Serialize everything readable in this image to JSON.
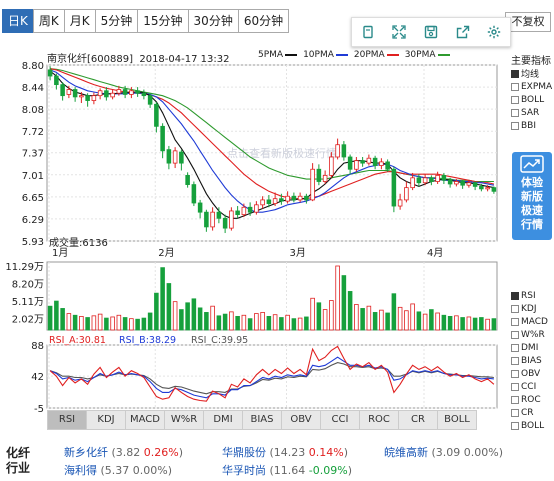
{
  "tabs": [
    "日K",
    "周K",
    "月K",
    "5分钟",
    "15分钟",
    "30分钟",
    "60分钟"
  ],
  "active_tab": 0,
  "fuquan_label": "不复权",
  "toolbar_icons": [
    "copy-icon",
    "fullscreen-icon",
    "save-icon",
    "share-icon",
    "settings-icon"
  ],
  "header": {
    "stock": "南京化纤[600889]",
    "datetime": "2018-04-17 13:32"
  },
  "ma_legend": [
    {
      "label": "5PMA",
      "color": "#111111"
    },
    {
      "label": "10PMA",
      "color": "#1f3bd6"
    },
    {
      "label": "20PMA",
      "color": "#e02020"
    },
    {
      "label": "30PMA",
      "color": "#2e9a2e"
    }
  ],
  "watermark": "点击查看新版极速行情",
  "side_title": "主要指标",
  "side_items": [
    {
      "label": "均线",
      "on": true
    },
    {
      "label": "EXPMA",
      "on": false
    },
    {
      "label": "BOLL",
      "on": false
    },
    {
      "label": "SAR",
      "on": false
    },
    {
      "label": "BBI",
      "on": false
    }
  ],
  "promo_text": "体验新版极速行情",
  "price_axis": [
    "8.80",
    "8.44",
    "8.08",
    "7.72",
    "7.37",
    "7.01",
    "6.65",
    "6.29",
    "5.93"
  ],
  "months": [
    "1月",
    "2月",
    "3月",
    "4月"
  ],
  "volume": {
    "label": "成交量:6136",
    "axis": [
      "11.29万",
      "8.20万",
      "5.11万",
      "2.02万"
    ]
  },
  "rsi": {
    "a": "RSI_A:30.81",
    "b": "RSI_B:38.29",
    "c": "RSI_C:39.95",
    "axis": [
      "88",
      "42",
      "-5"
    ],
    "colors": [
      "#e02020",
      "#1f3bd6",
      "#555555"
    ]
  },
  "indicator_items": [
    {
      "label": "RSI",
      "on": true
    },
    {
      "label": "KDJ",
      "on": false
    },
    {
      "label": "MACD",
      "on": false
    },
    {
      "label": "W%R",
      "on": false
    },
    {
      "label": "DMI",
      "on": false
    },
    {
      "label": "BIAS",
      "on": false
    },
    {
      "label": "OBV",
      "on": false
    },
    {
      "label": "CCI",
      "on": false
    },
    {
      "label": "ROC",
      "on": false
    },
    {
      "label": "CR",
      "on": false
    },
    {
      "label": "BOLL",
      "on": false
    }
  ],
  "bottom_tabs": [
    "RSI",
    "KDJ",
    "MACD",
    "W%R",
    "DMI",
    "BIAS",
    "OBV",
    "CCI",
    "ROC",
    "CR",
    "BOLL"
  ],
  "active_bottom_tab": 0,
  "sector": "化纤行业",
  "related_stocks": [
    {
      "name": "新乡化纤",
      "price": "3.82",
      "change": "0.26%",
      "dir": "up"
    },
    {
      "name": "华鼎股份",
      "price": "14.23",
      "change": "0.14%",
      "dir": "up"
    },
    {
      "name": "皖维高新",
      "price": "3.09",
      "change": "0.00%",
      "dir": "flat"
    },
    {
      "name": "海利得",
      "price": "5.37",
      "change": "0.00%",
      "dir": "flat"
    },
    {
      "name": "华孚时尚",
      "price": "11.64",
      "change": "-0.09%",
      "dir": "down"
    }
  ],
  "chart_data": {
    "type": "candlestick",
    "ylim": [
      5.93,
      8.8
    ],
    "candles": [
      [
        8.72,
        8.62,
        8.78,
        8.55
      ],
      [
        8.62,
        8.48,
        8.66,
        8.4
      ],
      [
        8.48,
        8.3,
        8.52,
        8.22
      ],
      [
        8.32,
        8.4,
        8.46,
        8.26
      ],
      [
        8.4,
        8.28,
        8.44,
        8.2
      ],
      [
        8.28,
        8.3,
        8.36,
        8.18
      ],
      [
        8.3,
        8.22,
        8.34,
        8.12
      ],
      [
        8.22,
        8.3,
        8.35,
        8.16
      ],
      [
        8.3,
        8.38,
        8.42,
        8.24
      ],
      [
        8.38,
        8.28,
        8.44,
        8.22
      ],
      [
        8.28,
        8.34,
        8.4,
        8.24
      ],
      [
        8.34,
        8.4,
        8.46,
        8.3
      ],
      [
        8.4,
        8.32,
        8.46,
        8.26
      ],
      [
        8.32,
        8.38,
        8.44,
        8.26
      ],
      [
        8.38,
        8.34,
        8.44,
        8.28
      ],
      [
        8.34,
        8.3,
        8.4,
        8.24
      ],
      [
        8.3,
        8.16,
        8.34,
        8.1
      ],
      [
        8.16,
        7.8,
        8.2,
        7.7
      ],
      [
        7.8,
        7.4,
        7.85,
        7.28
      ],
      [
        7.42,
        7.2,
        7.48,
        7.1
      ],
      [
        7.2,
        7.4,
        7.46,
        7.12
      ],
      [
        7.38,
        7.2,
        7.42,
        7.08
      ],
      [
        7.0,
        6.85,
        7.05,
        6.8
      ],
      [
        6.85,
        6.55,
        6.9,
        6.5
      ],
      [
        6.55,
        6.4,
        6.6,
        6.3
      ],
      [
        6.4,
        6.16,
        6.44,
        6.08
      ],
      [
        6.16,
        6.4,
        6.48,
        6.1
      ],
      [
        6.4,
        6.3,
        6.48,
        6.22
      ],
      [
        6.3,
        6.14,
        6.36,
        6.06
      ],
      [
        6.14,
        6.42,
        6.48,
        6.1
      ],
      [
        6.42,
        6.36,
        6.5,
        6.3
      ],
      [
        6.36,
        6.48,
        6.54,
        6.32
      ],
      [
        6.48,
        6.4,
        6.56,
        6.34
      ],
      [
        6.4,
        6.52,
        6.58,
        6.36
      ],
      [
        6.52,
        6.6,
        6.66,
        6.46
      ],
      [
        6.6,
        6.54,
        6.68,
        6.48
      ],
      [
        6.54,
        6.62,
        6.72,
        6.5
      ],
      [
        6.62,
        6.58,
        6.7,
        6.52
      ],
      [
        6.58,
        6.66,
        6.74,
        6.54
      ],
      [
        6.66,
        6.6,
        6.72,
        6.56
      ],
      [
        6.6,
        6.66,
        6.72,
        6.56
      ],
      [
        6.66,
        6.6,
        6.7,
        6.54
      ],
      [
        6.6,
        7.1,
        7.2,
        6.58
      ],
      [
        7.1,
        6.9,
        7.18,
        6.84
      ],
      [
        6.9,
        7.0,
        7.08,
        6.86
      ],
      [
        7.0,
        7.3,
        7.38,
        6.96
      ],
      [
        7.3,
        7.5,
        7.6,
        7.26
      ],
      [
        7.5,
        7.3,
        7.56,
        7.24
      ],
      [
        7.3,
        7.1,
        7.34,
        7.02
      ],
      [
        7.1,
        7.24,
        7.3,
        7.06
      ],
      [
        7.24,
        7.2,
        7.3,
        7.14
      ],
      [
        7.2,
        7.28,
        7.34,
        7.16
      ],
      [
        7.28,
        7.16,
        7.32,
        7.1
      ],
      [
        7.16,
        7.22,
        7.28,
        7.1
      ],
      [
        7.22,
        7.1,
        7.26,
        7.06
      ],
      [
        7.1,
        6.5,
        7.14,
        6.4
      ],
      [
        6.5,
        6.6,
        6.7,
        6.44
      ],
      [
        6.6,
        6.8,
        6.9,
        6.56
      ],
      [
        6.8,
        6.96,
        7.04,
        6.76
      ],
      [
        6.96,
        6.88,
        7.02,
        6.82
      ],
      [
        6.88,
        6.96,
        7.02,
        6.84
      ],
      [
        6.96,
        6.9,
        7.0,
        6.84
      ],
      [
        6.9,
        7.0,
        7.06,
        6.86
      ],
      [
        7.0,
        6.92,
        7.04,
        6.86
      ],
      [
        6.92,
        6.86,
        6.96,
        6.8
      ],
      [
        6.86,
        6.9,
        6.94,
        6.82
      ],
      [
        6.9,
        6.84,
        6.92,
        6.78
      ],
      [
        6.84,
        6.88,
        6.92,
        6.8
      ],
      [
        6.88,
        6.82,
        6.9,
        6.76
      ],
      [
        6.82,
        6.78,
        6.86,
        6.74
      ],
      [
        6.78,
        6.8,
        6.84,
        6.74
      ],
      [
        6.8,
        6.74,
        6.82,
        6.7
      ]
    ],
    "ma5": [
      8.7,
      8.62,
      8.5,
      8.42,
      8.36,
      8.33,
      8.3,
      8.3,
      8.32,
      8.33,
      8.33,
      8.34,
      8.35,
      8.36,
      8.36,
      8.35,
      8.3,
      8.2,
      8.02,
      7.8,
      7.58,
      7.44,
      7.28,
      7.1,
      6.9,
      6.7,
      6.55,
      6.42,
      6.34,
      6.3,
      6.3,
      6.34,
      6.38,
      6.42,
      6.46,
      6.5,
      6.54,
      6.58,
      6.6,
      6.6,
      6.62,
      6.62,
      6.72,
      6.78,
      6.86,
      6.96,
      7.1,
      7.2,
      7.22,
      7.24,
      7.24,
      7.22,
      7.2,
      7.2,
      7.18,
      7.06,
      6.96,
      6.9,
      6.86,
      6.82,
      6.86,
      6.9,
      6.92,
      6.94,
      6.92,
      6.9,
      6.88,
      6.88,
      6.86,
      6.84,
      6.82,
      6.8
    ],
    "ma10": [
      8.72,
      8.68,
      8.6,
      8.52,
      8.46,
      8.42,
      8.38,
      8.36,
      8.34,
      8.33,
      8.33,
      8.33,
      8.33,
      8.34,
      8.34,
      8.34,
      8.32,
      8.28,
      8.2,
      8.08,
      7.96,
      7.84,
      7.7,
      7.56,
      7.4,
      7.24,
      7.08,
      6.94,
      6.8,
      6.68,
      6.58,
      6.5,
      6.44,
      6.4,
      6.4,
      6.42,
      6.44,
      6.48,
      6.52,
      6.54,
      6.56,
      6.58,
      6.62,
      6.66,
      6.72,
      6.8,
      6.88,
      6.96,
      7.02,
      7.06,
      7.1,
      7.14,
      7.16,
      7.18,
      7.18,
      7.14,
      7.08,
      7.04,
      7.0,
      6.98,
      6.96,
      6.96,
      6.94,
      6.92,
      6.92,
      6.92,
      6.9,
      6.9,
      6.88,
      6.88,
      6.86,
      6.84
    ],
    "ma20": [
      8.74,
      8.72,
      8.68,
      8.64,
      8.6,
      8.56,
      8.52,
      8.48,
      8.45,
      8.42,
      8.4,
      8.38,
      8.36,
      8.35,
      8.34,
      8.33,
      8.31,
      8.28,
      8.24,
      8.18,
      8.1,
      8.02,
      7.92,
      7.82,
      7.72,
      7.62,
      7.52,
      7.42,
      7.32,
      7.22,
      7.12,
      7.02,
      6.94,
      6.86,
      6.8,
      6.74,
      6.7,
      6.66,
      6.64,
      6.62,
      6.62,
      6.62,
      6.64,
      6.66,
      6.7,
      6.74,
      6.78,
      6.82,
      6.86,
      6.9,
      6.94,
      6.98,
      7.02,
      7.04,
      7.06,
      7.06,
      7.04,
      7.02,
      7.02,
      7.02,
      7.02,
      7.02,
      7.02,
      7.0,
      6.98,
      6.96,
      6.94,
      6.92,
      6.9,
      6.88,
      6.88,
      6.86
    ],
    "ma30": [
      8.74,
      8.73,
      8.71,
      8.68,
      8.65,
      8.62,
      8.59,
      8.56,
      8.53,
      8.5,
      8.47,
      8.44,
      8.42,
      8.4,
      8.38,
      8.36,
      8.34,
      8.32,
      8.3,
      8.26,
      8.22,
      8.16,
      8.1,
      8.02,
      7.94,
      7.86,
      7.78,
      7.7,
      7.62,
      7.54,
      7.46,
      7.38,
      7.3,
      7.24,
      7.18,
      7.12,
      7.08,
      7.04,
      7.0,
      6.98,
      6.96,
      6.94,
      6.94,
      6.94,
      6.94,
      6.96,
      6.98,
      7.0,
      7.02,
      7.04,
      7.06,
      7.08,
      7.08,
      7.08,
      7.08,
      7.06,
      7.04,
      7.02,
      7.0,
      6.98,
      6.96,
      6.96,
      6.96,
      6.94,
      6.94,
      6.92,
      6.92,
      6.92,
      6.9,
      6.9,
      6.9,
      6.9
    ],
    "volumes": [
      4.2,
      5.1,
      3.8,
      2.9,
      2.6,
      2.4,
      2.2,
      2.5,
      2.8,
      2.1,
      2.3,
      2.6,
      2.2,
      2.0,
      1.9,
      2.1,
      3.0,
      6.5,
      11.0,
      8.2,
      5.0,
      3.6,
      4.8,
      5.5,
      3.9,
      3.1,
      4.2,
      2.5,
      2.8,
      3.2,
      2.4,
      2.6,
      2.0,
      2.9,
      3.1,
      2.4,
      2.7,
      2.2,
      2.6,
      2.0,
      2.1,
      2.3,
      5.6,
      4.8,
      3.6,
      5.2,
      11.29,
      9.6,
      6.8,
      4.5,
      3.8,
      4.2,
      3.1,
      3.5,
      3.0,
      6.4,
      4.0,
      3.4,
      4.6,
      3.2,
      2.8,
      3.6,
      3.0,
      2.6,
      2.4,
      2.5,
      2.2,
      2.3,
      2.1,
      2.2,
      1.9,
      2.0
    ],
    "rsi_a": [
      50,
      42,
      28,
      40,
      32,
      38,
      30,
      45,
      55,
      40,
      48,
      55,
      42,
      50,
      46,
      40,
      26,
      12,
      8,
      10,
      25,
      18,
      12,
      8,
      6,
      5,
      20,
      16,
      10,
      30,
      26,
      38,
      32,
      44,
      52,
      44,
      52,
      46,
      54,
      46,
      52,
      44,
      82,
      65,
      70,
      80,
      86,
      68,
      52,
      60,
      56,
      62,
      52,
      58,
      48,
      18,
      30,
      45,
      58,
      52,
      56,
      50,
      56,
      48,
      42,
      46,
      40,
      44,
      38,
      34,
      38,
      30
    ],
    "rsi_b": [
      50,
      46,
      38,
      40,
      36,
      38,
      34,
      40,
      46,
      42,
      44,
      48,
      44,
      46,
      44,
      42,
      34,
      24,
      18,
      18,
      24,
      22,
      18,
      14,
      12,
      10,
      16,
      16,
      14,
      22,
      22,
      28,
      28,
      34,
      40,
      38,
      42,
      40,
      44,
      42,
      44,
      42,
      58,
      56,
      58,
      64,
      70,
      64,
      58,
      58,
      56,
      58,
      54,
      56,
      52,
      36,
      38,
      44,
      50,
      48,
      50,
      48,
      50,
      46,
      44,
      44,
      42,
      42,
      40,
      38,
      39,
      38
    ],
    "rsi_c": [
      50,
      47,
      42,
      42,
      40,
      40,
      38,
      40,
      44,
      42,
      44,
      46,
      44,
      45,
      44,
      43,
      38,
      30,
      25,
      24,
      27,
      26,
      23,
      20,
      18,
      16,
      19,
      19,
      18,
      23,
      23,
      27,
      28,
      32,
      37,
      36,
      39,
      38,
      41,
      40,
      42,
      41,
      52,
      51,
      53,
      58,
      62,
      60,
      56,
      56,
      55,
      56,
      53,
      54,
      52,
      42,
      42,
      45,
      49,
      47,
      49,
      47,
      49,
      46,
      45,
      44,
      43,
      43,
      42,
      41,
      41,
      40
    ],
    "rsi_ylim": [
      -5,
      88
    ]
  }
}
